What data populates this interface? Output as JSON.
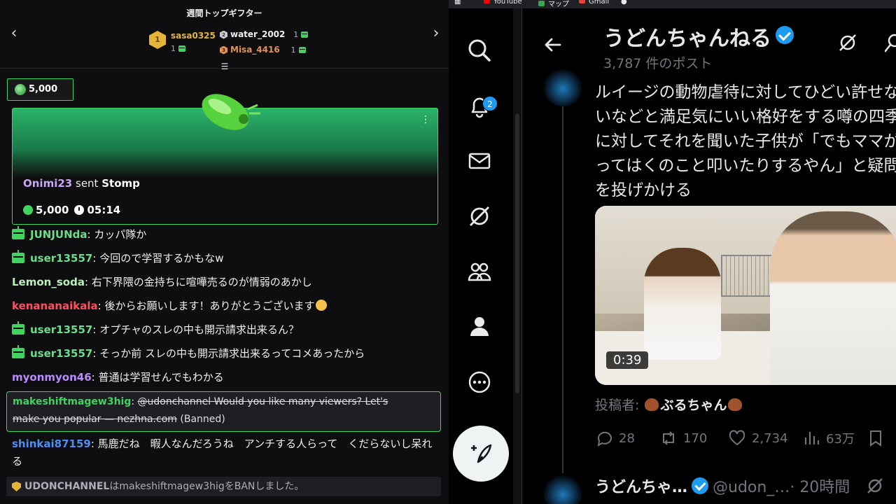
{
  "chat": {
    "gifter_title": "週間トップギフター",
    "top_gifters": [
      {
        "rank": "1",
        "name": "sasa0325",
        "count": "1",
        "color": "#e5b53b"
      },
      {
        "rank": "2",
        "name": "water_2002",
        "count": "1",
        "color": "#c9c9d1"
      },
      {
        "rank": "3",
        "name": "Misa_4416",
        "count": "1",
        "color": "#e0915a"
      }
    ],
    "bits_pill": "5,000",
    "gift_card": {
      "sender": "Onimi23",
      "verb": "sent",
      "item": "Stomp",
      "amount": "5,000",
      "timer": "05:14"
    },
    "messages": [
      {
        "user": "JUNJUNda",
        "color": "#6ddc8a",
        "badge": true,
        "text": ": カッパ隊か"
      },
      {
        "user": "user13557",
        "color": "#6ddc8a",
        "badge": true,
        "text": ": 今回ので学習するかもなw"
      },
      {
        "user": "Lemon_soda",
        "color": "#b9f0b9",
        "badge": false,
        "text": ": 右下界隈の金持ちに喧嘩売るのが情弱のあかし"
      },
      {
        "user": "kenananaikala",
        "color": "#ff4f5e",
        "badge": false,
        "text": ": 後からお願いします！ありがとうございます"
      },
      {
        "user": "user13557",
        "color": "#6ddc8a",
        "badge": true,
        "text": ": オプチャのスレの中も開示請求出来るん？"
      },
      {
        "user": "user13557",
        "color": "#6ddc8a",
        "badge": true,
        "text": ": そっか前 スレの中も開示請求出来るってコメあったから"
      },
      {
        "user": "myonmyon46",
        "color": "#b98bff",
        "badge": false,
        "text": ": 普通は学習せんでもわかる"
      }
    ],
    "banned_message": {
      "user": "makeshiftmagew3hig",
      "text_line1": "@udonchannel Would you like many viewers? Let's",
      "text_line2": "make you popular — nezhna.com",
      "tag": "(Banned)"
    },
    "last_message": {
      "user": "shinkai87159",
      "color": "#4f8ef7",
      "text": ": 馬鹿だね　暇人なんだろうね　アンチする人らって　くだらないし呆れる"
    },
    "ban_notice": {
      "actor": "UDONCHANNEL",
      "p1": "は",
      "target": "makeshiftmagew3hig",
      "p2": "をBANしました。"
    }
  },
  "browser": {
    "bookmarks": [
      {
        "label": "YouTube",
        "color": "#ff0000"
      },
      {
        "label": "マップ",
        "color": "#34a853"
      },
      {
        "label": "Gmail",
        "color": "#ea4335"
      }
    ]
  },
  "x": {
    "notifications_count": "2",
    "profile_name": "うどんちゃんねる",
    "post_count": "3,787 件のポスト",
    "tweet_text": "ルイージの動物虐待に対してひどい許せな\nいなどと満足気にいい格好をする噂の四季\nに対してそれを聞いた子供が「でもママが\nってはくのこと叩いたりするやん」と疑問\nを投げかける",
    "video_duration": "0:39",
    "poster_label": "投稿者:",
    "poster_name": "ぶるちゃん",
    "stats": {
      "replies": "28",
      "reposts": "170",
      "likes": "2,734",
      "views": "63万"
    },
    "next_post": {
      "name": "うどんちゃ…",
      "handle": "@udon_…",
      "time": "· 20時間"
    }
  }
}
